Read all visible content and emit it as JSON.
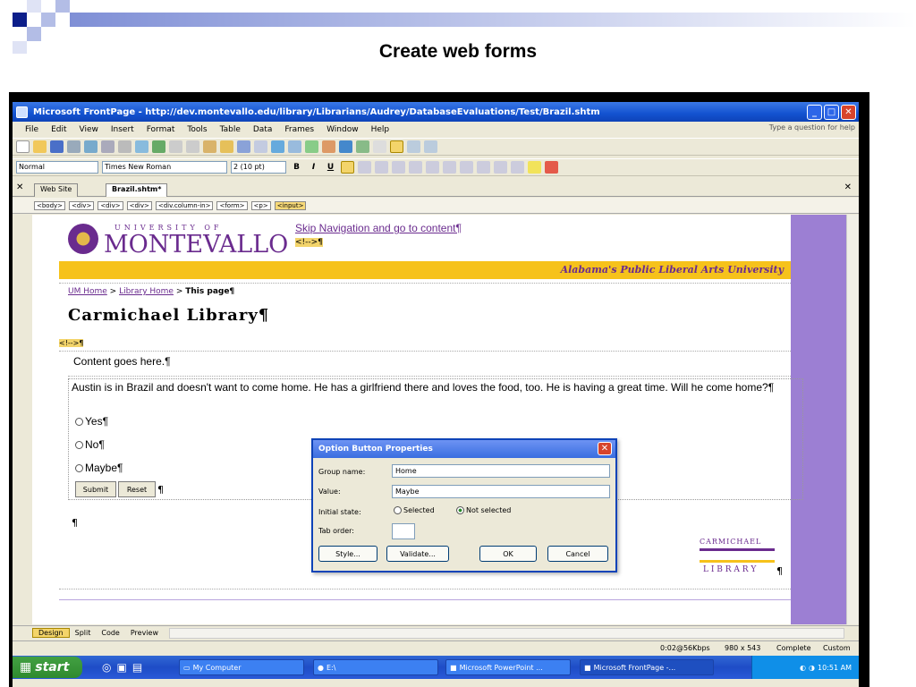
{
  "slide": {
    "title": "Create web forms"
  },
  "window": {
    "title": "Microsoft FrontPage - http://dev.montevallo.edu/library/Librarians/Audrey/DatabaseEvaluations/Test/Brazil.shtm",
    "minimize": "_",
    "maximize": "□",
    "close": "✕"
  },
  "menu": {
    "items": [
      "File",
      "Edit",
      "View",
      "Insert",
      "Format",
      "Tools",
      "Table",
      "Data",
      "Frames",
      "Window",
      "Help"
    ],
    "ask_placeholder": "Type a question for help"
  },
  "format_toolbar": {
    "style": "Normal",
    "font": "Times New Roman",
    "size": "2 (10 pt)",
    "bold": "B",
    "italic": "I",
    "underline": "U"
  },
  "tabs": [
    {
      "label": "Web Site"
    },
    {
      "label": "Brazil.shtm*"
    }
  ],
  "tag_selector": [
    "<body>",
    "<div>",
    "<div>",
    "<div>",
    "<div.column-in>",
    "<form>",
    "<p>",
    "<input>"
  ],
  "page": {
    "logo_top": "UNIVERSITY OF",
    "logo_main": "MONTEVALLO",
    "skip_link": "Skip Navigation and go to content¶",
    "ssi_tag": "<!-->¶",
    "tagline": "Alabama's Public Liberal Arts University",
    "breadcrumb": {
      "home": "UM Home",
      "sep1": " > ",
      "library": "Library Home",
      "sep2": " > ",
      "current": "This page¶"
    },
    "heading": "Carmichael Library¶",
    "content_placeholder": "Content goes here.¶",
    "question": "Austin is in Brazil and doesn't want to come home.  He has a girlfriend there and loves the food, too.  He is having a great time.  Will he come home?¶",
    "options": [
      {
        "label": "Yes¶"
      },
      {
        "label": "No¶"
      },
      {
        "label": "Maybe¶"
      }
    ],
    "submit": "Submit",
    "reset": "Reset",
    "pilcrow": "¶",
    "footer_logo_top": "CARMICHAEL",
    "footer_logo_bottom": "L I B R A R Y"
  },
  "dialog": {
    "title": "Option Button Properties",
    "group_label": "Group name:",
    "group_value": "Home",
    "value_label": "Value:",
    "value_value": "Maybe",
    "state_label": "Initial state:",
    "state_selected": "Selected",
    "state_not_selected": "Not selected",
    "tab_label": "Tab order:",
    "tab_value": "",
    "style_btn": "Style...",
    "validate_btn": "Validate...",
    "ok_btn": "OK",
    "cancel_btn": "Cancel"
  },
  "views": {
    "design": "Design",
    "split": "Split",
    "code": "Code",
    "preview": "Preview"
  },
  "status": {
    "speed": "0:02@56Kbps",
    "size": "980 x 543",
    "state": "Complete",
    "mode": "Custom"
  },
  "taskbar": {
    "start": "start",
    "tasks": [
      "My Computer",
      "E:\\",
      "Microsoft PowerPoint ...",
      "Microsoft FrontPage -..."
    ],
    "clock": "10:51 AM"
  },
  "colors": {
    "page_bg": "#9c7fd3",
    "brand_purple": "#6a2b8e",
    "tagline_bar": "#f6c21b",
    "xp_blue": "#1352d0"
  }
}
